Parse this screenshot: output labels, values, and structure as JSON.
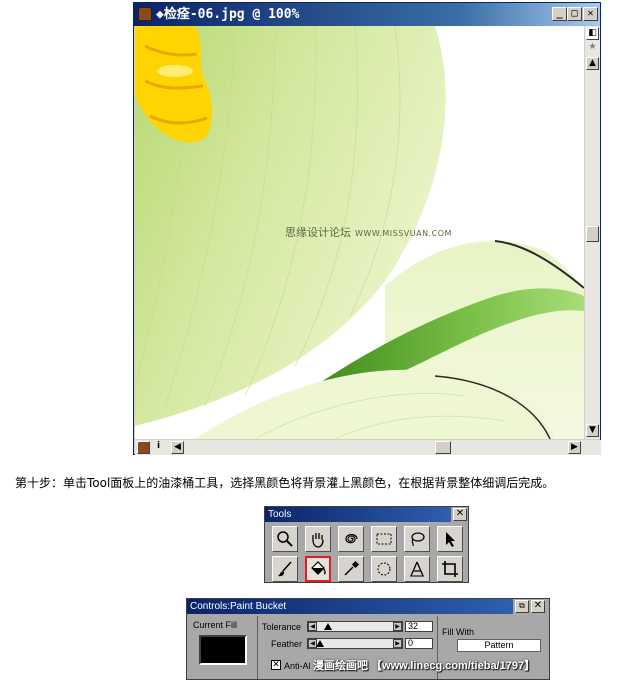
{
  "image_window": {
    "title": "◆检痊-06.jpg @ 100%",
    "buttons": [
      "minimize",
      "maximize",
      "close"
    ],
    "watermark_cn": "思缘设计论坛",
    "watermark_url": "WWW.MISSVUAN.COM"
  },
  "step_text": "第十步：单击Tool面板上的油漆桶工具，选择黑颜色将背景灌上黑颜色，在根据背景整体细调后完成。",
  "tools_palette": {
    "title": "Tools",
    "close_label": "✕",
    "tools": [
      {
        "name": "zoom-tool",
        "icon": "magnifier-icon",
        "active": false
      },
      {
        "name": "hand-tool",
        "icon": "hand-icon",
        "active": false
      },
      {
        "name": "twirl-tool",
        "icon": "spiral-icon",
        "active": false
      },
      {
        "name": "rect-select-tool",
        "icon": "marquee-icon",
        "active": false
      },
      {
        "name": "lasso-tool",
        "icon": "lasso-icon",
        "active": false
      },
      {
        "name": "pointer-tool",
        "icon": "arrow-icon",
        "active": false
      },
      {
        "name": "brush-tool",
        "icon": "brush-icon",
        "active": false
      },
      {
        "name": "paint-bucket-tool",
        "icon": "bucket-icon",
        "active": true
      },
      {
        "name": "eyedropper-tool",
        "icon": "eyedropper-icon",
        "active": false
      },
      {
        "name": "circle-select-tool",
        "icon": "circle-icon",
        "active": false
      },
      {
        "name": "text-tool",
        "icon": "text-icon",
        "active": false
      },
      {
        "name": "crop-tool",
        "icon": "crop-icon",
        "active": false
      }
    ]
  },
  "controls_panel": {
    "title": "Controls:Paint Bucket",
    "current_fill_label": "Current Fill",
    "current_fill_color": "#000000",
    "tolerance_label": "Tolerance",
    "tolerance_value": "32",
    "feather_label": "Feather",
    "feather_value": "0",
    "fill_with_label": "Fill With",
    "fill_with_value": "Pattern",
    "anti_alias_label": "Anti-Al",
    "anti_alias_checked": true,
    "site_watermark": "漫画绘画吧 【www.linecg.com/tieba/1797】"
  },
  "colors": {
    "title_bar": "#0a246a",
    "leaf_light": "#e8f4c0",
    "leaf_green": "#8cc63f",
    "stamen_yellow": "#ffd400",
    "active_tool_border": "#e02020"
  }
}
